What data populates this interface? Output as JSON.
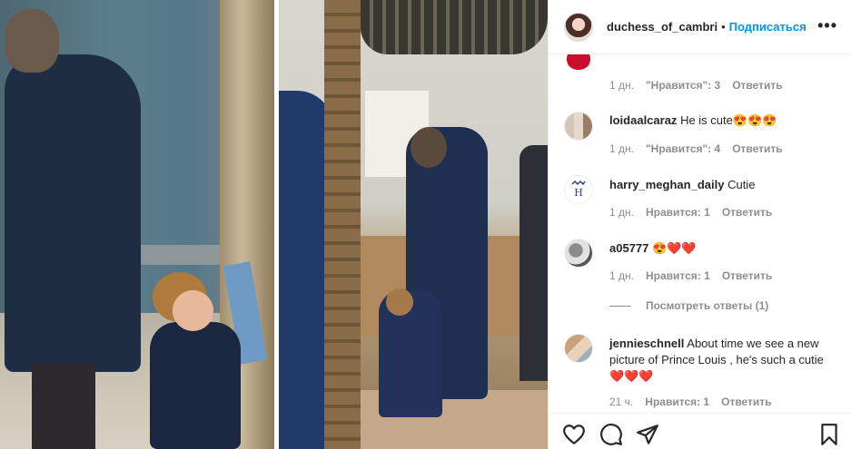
{
  "post": {
    "username": "duchess_of_cambri",
    "dot": "•",
    "follow_label": "Подписаться",
    "more_label": "•••"
  },
  "comments": [
    {
      "username": "",
      "text": "",
      "time": "1 дн.",
      "likes": "\"Нравится\": 3",
      "reply": "Ответить"
    },
    {
      "username": "loidaalcaraz",
      "text": "He is cute",
      "emoji": "😍😍😍",
      "time": "1 дн.",
      "likes": "\"Нравится\": 4",
      "reply": "Ответить"
    },
    {
      "username": "harry_meghan_daily",
      "text": "Cutie",
      "emoji": "",
      "time": "1 дн.",
      "likes": "Нравится: 1",
      "reply": "Ответить"
    },
    {
      "username": "a05777",
      "text": "",
      "emoji": "😍❤️❤️",
      "time": "1 дн.",
      "likes": "Нравится: 1",
      "reply": "Ответить"
    },
    {
      "username": "jennieschnell",
      "text": "About time we see a new picture of Prince Louis , he's such a cutie",
      "emoji": "❤️❤️❤️",
      "time": "21 ч.",
      "likes": "Нравится: 1",
      "reply": "Ответить"
    }
  ],
  "view_replies_label": "Посмотреть ответы (1)",
  "icons": {
    "like": "heart-icon",
    "comment": "comment-icon",
    "share": "share-icon",
    "save": "bookmark-icon",
    "more": "more-icon"
  },
  "colors": {
    "link_blue": "#0095f6",
    "text": "#262626",
    "muted": "#8e8e8e",
    "heart_red": "#ed4956"
  }
}
